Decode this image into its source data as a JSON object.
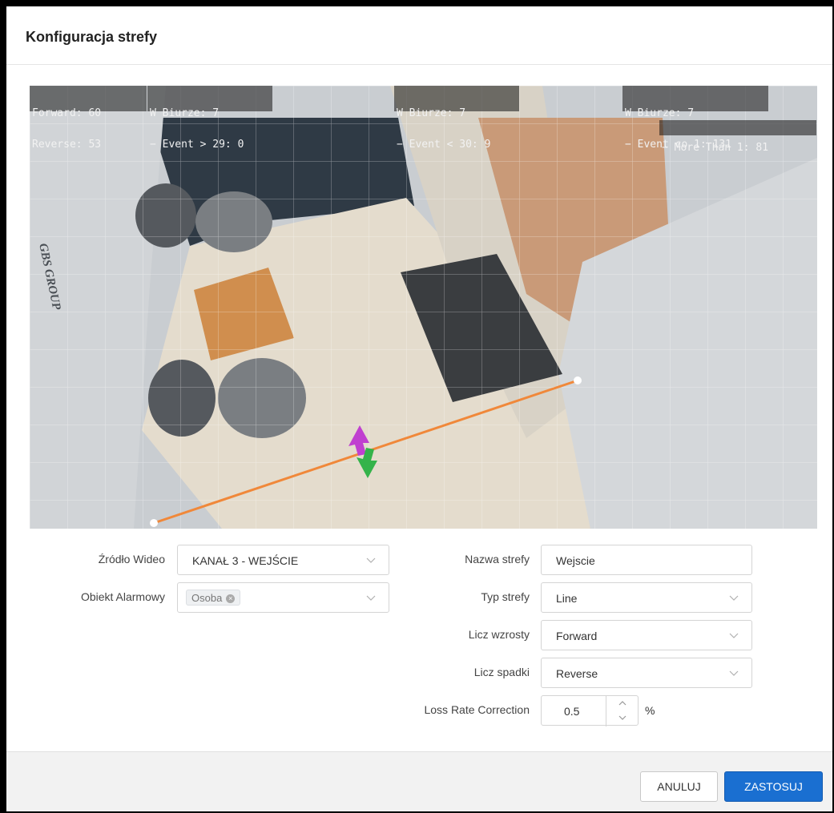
{
  "modal": {
    "title": "Konfiguracja strefy"
  },
  "video": {
    "overlay_left": {
      "line1": "Forward: 60",
      "line2": "Reverse: 53"
    },
    "overlay_zone1": {
      "line1": "W Biurze: 7",
      "line2": "− Event > 29: 0"
    },
    "overlay_zone2": {
      "line1": "W Biurze: 7",
      "line2": "− Event < 30: 9"
    },
    "overlay_zone3": {
      "line1": "W Biurze: 7",
      "line2": "− Event co 1: 131",
      "line3": "− More Than 1: 81"
    },
    "sign_text": "GBS GROUP",
    "line_color": "#f0883a",
    "forward_arrow_color": "#c040d0",
    "reverse_arrow_color": "#34b34a"
  },
  "form": {
    "video_source": {
      "label": "Źródło Wideo",
      "value": "KANAŁ 3 - WEJŚCIE"
    },
    "alarm_object": {
      "label": "Obiekt Alarmowy",
      "tag": "Osoba"
    },
    "zone_name": {
      "label": "Nazwa strefy",
      "value": "Wejscie"
    },
    "zone_type": {
      "label": "Typ strefy",
      "value": "Line"
    },
    "count_rises": {
      "label": "Licz wzrosty",
      "value": "Forward"
    },
    "count_drops": {
      "label": "Licz spadki",
      "value": "Reverse"
    },
    "loss_rate": {
      "label": "Loss Rate Correction",
      "value": "0.5",
      "unit": "%"
    }
  },
  "footer": {
    "cancel_label": "ANULUJ",
    "apply_label": "ZASTOSUJ"
  },
  "colors": {
    "primary": "#1a6fd1",
    "footer_bg": "#f2f2f2"
  }
}
